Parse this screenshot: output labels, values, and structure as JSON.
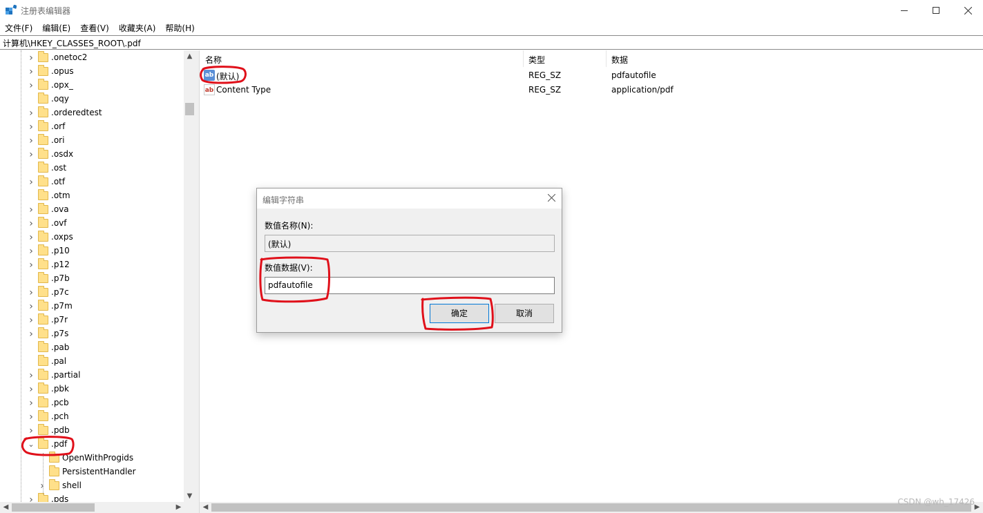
{
  "window": {
    "title": "注册表编辑器",
    "icon": "regedit-icon",
    "controls": [
      "minimize-icon",
      "maximize-icon",
      "close-icon"
    ]
  },
  "menu": [
    "文件(F)",
    "编辑(E)",
    "查看(V)",
    "收藏夹(A)",
    "帮助(H)"
  ],
  "address": "计算机\\HKEY_CLASSES_ROOT\\.pdf",
  "tree": {
    "items": [
      {
        "label": ".onetoc2",
        "expandable": true
      },
      {
        "label": ".opus",
        "expandable": true
      },
      {
        "label": ".opx_",
        "expandable": true
      },
      {
        "label": ".oqy",
        "expandable": false
      },
      {
        "label": ".orderedtest",
        "expandable": true
      },
      {
        "label": ".orf",
        "expandable": true
      },
      {
        "label": ".ori",
        "expandable": true
      },
      {
        "label": ".osdx",
        "expandable": true
      },
      {
        "label": ".ost",
        "expandable": false
      },
      {
        "label": ".otf",
        "expandable": true
      },
      {
        "label": ".otm",
        "expandable": false
      },
      {
        "label": ".ova",
        "expandable": true
      },
      {
        "label": ".ovf",
        "expandable": true
      },
      {
        "label": ".oxps",
        "expandable": true
      },
      {
        "label": ".p10",
        "expandable": true
      },
      {
        "label": ".p12",
        "expandable": true
      },
      {
        "label": ".p7b",
        "expandable": false
      },
      {
        "label": ".p7c",
        "expandable": true
      },
      {
        "label": ".p7m",
        "expandable": true
      },
      {
        "label": ".p7r",
        "expandable": true
      },
      {
        "label": ".p7s",
        "expandable": true
      },
      {
        "label": ".pab",
        "expandable": false
      },
      {
        "label": ".pal",
        "expandable": false
      },
      {
        "label": ".partial",
        "expandable": true
      },
      {
        "label": ".pbk",
        "expandable": true
      },
      {
        "label": ".pcb",
        "expandable": true
      },
      {
        "label": ".pch",
        "expandable": true
      },
      {
        "label": ".pdb",
        "expandable": true
      },
      {
        "label": ".pdf",
        "expandable": true,
        "expanded": true
      },
      {
        "label": "OpenWithProgids",
        "child": true
      },
      {
        "label": "PersistentHandler",
        "child": true
      },
      {
        "label": "shell",
        "child": true,
        "expandable": true
      },
      {
        "label": ".pds",
        "expandable": true
      }
    ]
  },
  "list": {
    "headers": [
      "名称",
      "类型",
      "数据"
    ],
    "rows": [
      {
        "icon": "string-value-icon",
        "name": "(默认)",
        "type": "REG_SZ",
        "data": "pdfautofile"
      },
      {
        "icon": "string-value-icon",
        "name": "Content Type",
        "type": "REG_SZ",
        "data": "application/pdf"
      }
    ]
  },
  "dialog": {
    "title": "编辑字符串",
    "name_label": "数值名称(N):",
    "name_value": "(默认)",
    "data_label": "数值数据(V):",
    "data_value": "pdfautofile",
    "ok_label": "确定",
    "cancel_label": "取消"
  },
  "watermark": "CSDN @wh_17426",
  "colors": {
    "folder": "#ffe08a",
    "annotation": "#e0101a",
    "accent": "#0078d7"
  }
}
